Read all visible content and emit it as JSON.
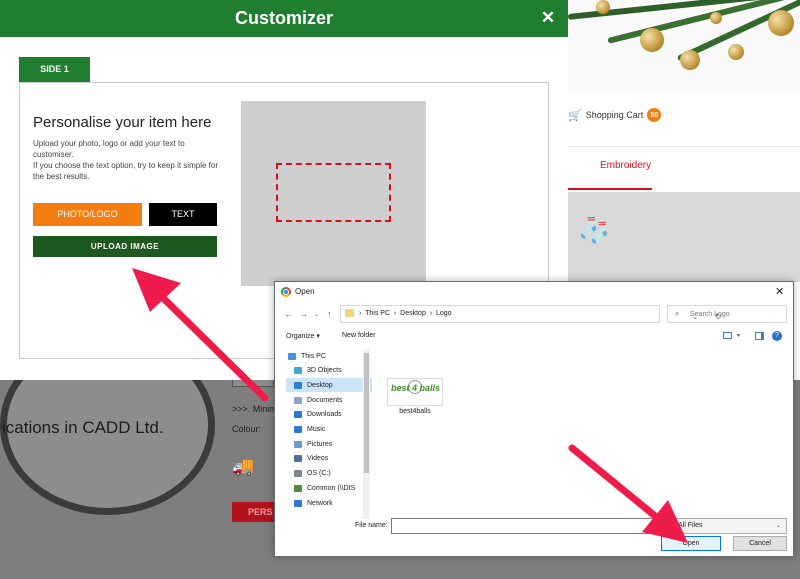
{
  "background_page": {
    "cart_label": "Shopping Cart",
    "cart_count": "50",
    "nav_active": "Embroidery",
    "company_text": "ications in CADD Ltd.",
    "min_text": ">>>. Minim",
    "colour_label": "Colour:",
    "pers_button": "PERS"
  },
  "customizer": {
    "title": "Customizer",
    "close_glyph": "✕",
    "side_tab": "SIDE 1",
    "heading": "Personalise your item here",
    "description_1": "Upload your photo, logo or add your text to customiser.",
    "description_2": "If you choose the text option, try to keep it simple for the best results.",
    "photo_button": "PHOTO/LOGO",
    "text_button": "TEXT",
    "upload_button": "UPLOAD IMAGE"
  },
  "open_dialog": {
    "title": "Open",
    "close_glyph": "✕",
    "breadcrumb": [
      "This PC",
      "Desktop",
      "Logo"
    ],
    "search_placeholder": "Search Logo",
    "organize_label": "Organize ▾",
    "new_folder_label": "New folder",
    "tree": [
      {
        "label": "This PC",
        "color": "#4a90d9",
        "selected": false
      },
      {
        "label": "3D Objects",
        "color": "#3fa7d6",
        "selected": false
      },
      {
        "label": "Desktop",
        "color": "#2f7fd1",
        "selected": true
      },
      {
        "label": "Documents",
        "color": "#8aa4c1",
        "selected": false
      },
      {
        "label": "Downloads",
        "color": "#2b78d4",
        "selected": false
      },
      {
        "label": "Music",
        "color": "#2b78d4",
        "selected": false
      },
      {
        "label": "Pictures",
        "color": "#6e9cc8",
        "selected": false
      },
      {
        "label": "Videos",
        "color": "#4d6f94",
        "selected": false
      },
      {
        "label": "OS (C:)",
        "color": "#7b8794",
        "selected": false
      },
      {
        "label": "Common (\\\\DIS",
        "color": "#4c8c3a",
        "selected": false
      },
      {
        "label": "Network",
        "color": "#2b78d4",
        "selected": false
      }
    ],
    "file": {
      "name": "best4balls",
      "logo_text": "best 4 balls"
    },
    "filename_label": "File name:",
    "filename_value": "",
    "filetype_value": "All Files",
    "open_button": "Open",
    "cancel_button": "Cancel"
  },
  "colors": {
    "header_green": "#1f7e2f",
    "upload_green": "#1e5a1f",
    "orange": "#f57c0f",
    "arrow_red": "#ee1c4a",
    "print_area_red": "#d5101b"
  }
}
